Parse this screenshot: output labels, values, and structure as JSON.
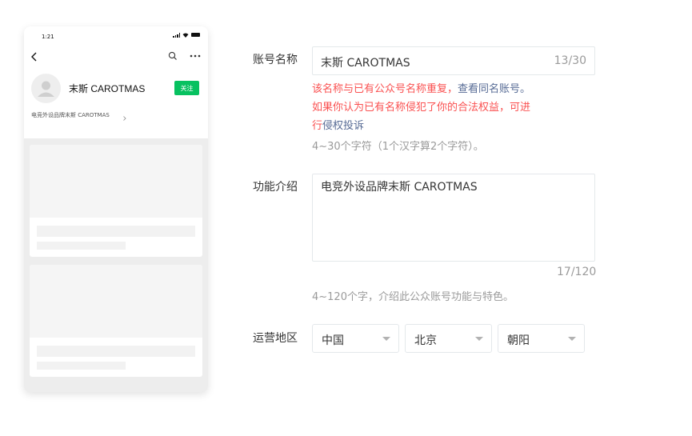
{
  "preview": {
    "status_time": "1:21",
    "account_name": "末斯 CAROTMAS",
    "follow_label": "关注",
    "intro_text": "电竞外设品牌末斯 CAROTMAS"
  },
  "form": {
    "account_name": {
      "label": "账号名称",
      "value": "末斯 CAROTMAS",
      "counter": "13/30",
      "error_line1_prefix": "该名称与已有公众号名称重复，",
      "error_line1_link": "查看同名账号。",
      "error_line2": "如果你认为已有名称侵犯了你的合法权益，可进",
      "error_line3_prefix": "行",
      "error_line3_link": "侵权投诉",
      "tip": "4~30个字符（1个汉字算2个字符）。"
    },
    "intro": {
      "label": "功能介绍",
      "value": "电竞外设品牌末斯 CAROTMAS",
      "counter": "17/120",
      "tip": "4~120个字，介绍此公众账号功能与特色。"
    },
    "region": {
      "label": "运营地区",
      "country": "中国",
      "province": "北京",
      "district": "朝阳"
    }
  },
  "colors": {
    "accent_green": "#07c160",
    "error_red": "#fa5151",
    "link_blue": "#576b95"
  }
}
